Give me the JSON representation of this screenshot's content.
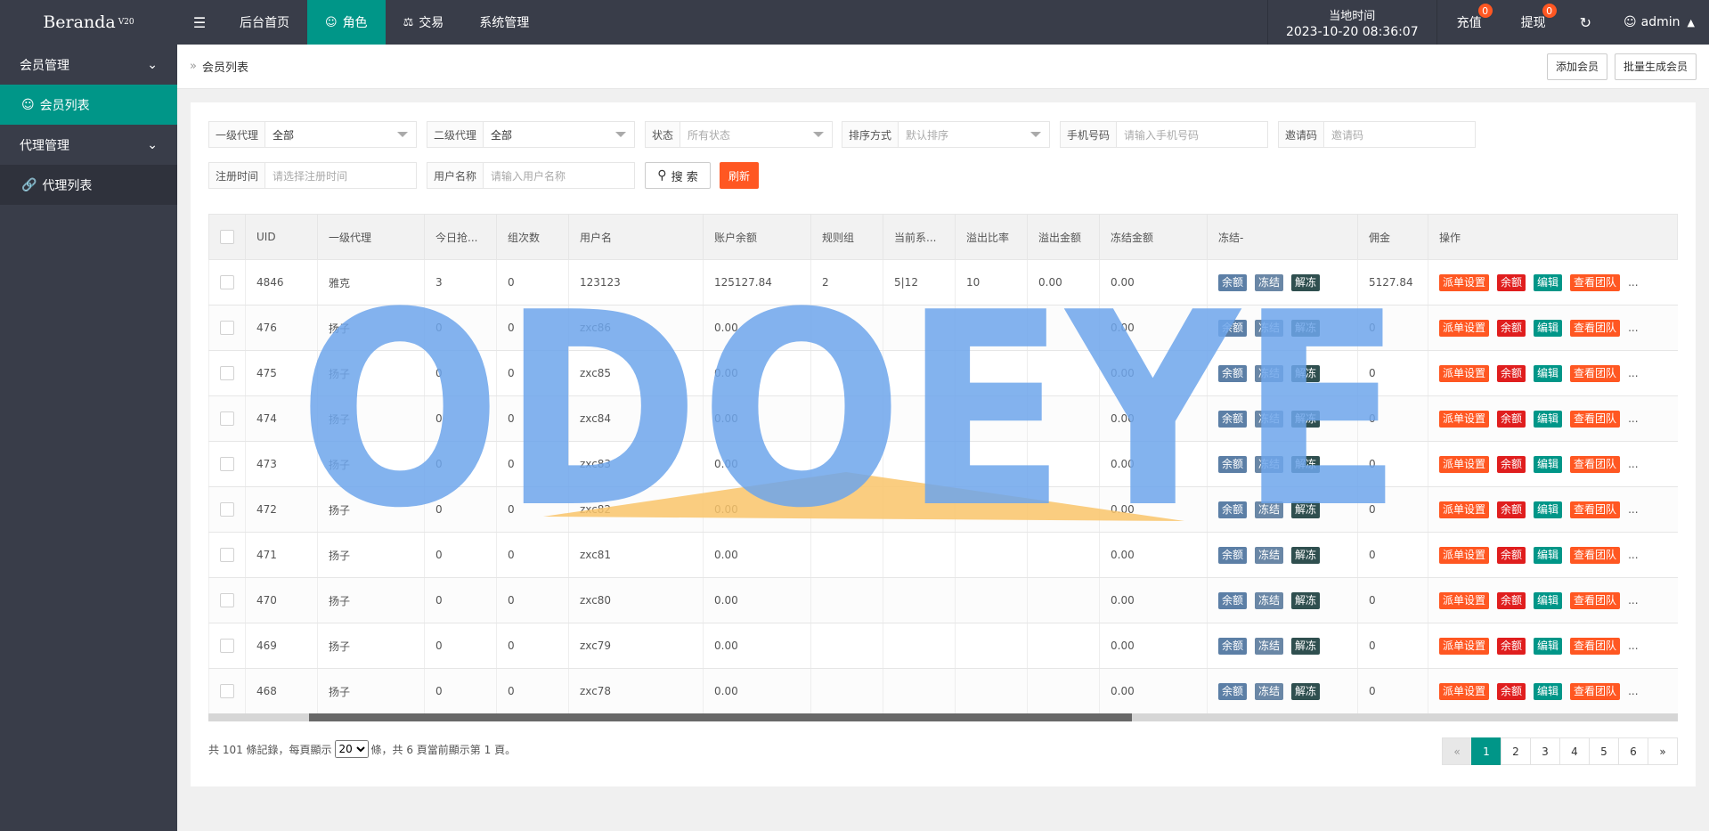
{
  "brand": {
    "name": "Beranda",
    "version": "V20"
  },
  "top_nav": {
    "menu_toggle_icon": "menu-icon",
    "items": [
      {
        "label": "后台首页",
        "icon": "",
        "active": false
      },
      {
        "label": "角色",
        "icon": "user-icon",
        "active": true
      },
      {
        "label": "交易",
        "icon": "scale-icon",
        "active": false
      },
      {
        "label": "系统管理",
        "icon": "",
        "active": false
      }
    ]
  },
  "header_right": {
    "time_label": "当地时间",
    "time_value": "2023-10-20 08:36:07",
    "recharge_label": "充值",
    "recharge_badge": "0",
    "withdraw_label": "提现",
    "withdraw_badge": "0",
    "refresh_icon": "refresh-icon",
    "user": "admin"
  },
  "sidebar": {
    "groups": [
      {
        "label": "会员管理",
        "items": [
          {
            "label": "会员列表",
            "active": true
          }
        ]
      },
      {
        "label": "代理管理",
        "items": [
          {
            "label": "代理列表",
            "active": false
          }
        ]
      }
    ]
  },
  "breadcrumb": {
    "title": "会员列表",
    "add_button": "添加会员",
    "batch_button": "批量生成会员"
  },
  "filters": {
    "agent1_label": "一级代理",
    "agent1_value": "全部",
    "agent2_label": "二级代理",
    "agent2_value": "全部",
    "status_label": "状态",
    "status_placeholder": "所有状态",
    "sort_label": "排序方式",
    "sort_placeholder": "默认排序",
    "phone_label": "手机号码",
    "phone_placeholder": "请输入手机号码",
    "invite_label": "邀请码",
    "invite_placeholder": "邀请码",
    "regtime_label": "注册时间",
    "regtime_placeholder": "请选择注册时间",
    "username_label": "用户名称",
    "username_placeholder": "请输入用户名称",
    "search_button": "搜 索",
    "refresh_button": "刷新"
  },
  "table": {
    "headers": [
      "UID",
      "一级代理",
      "今日抢...",
      "组次数",
      "用户名",
      "账户余额",
      "规则组",
      "当前系...",
      "溢出比率",
      "溢出金额",
      "冻结金额",
      "冻结-",
      "佣金",
      "操作"
    ],
    "actions": {
      "balance": "余额",
      "freeze": "冻结",
      "unfreeze": "解冻",
      "dispatch": "派单设置",
      "balance2": "余额",
      "edit": "编辑",
      "team": "查看团队",
      "more": "..."
    },
    "rows": [
      {
        "uid": "4846",
        "agent": "雅克",
        "today": "3",
        "groups": "0",
        "username": "123123",
        "balance": "125127.84",
        "rule": "2",
        "current": "5|12",
        "overflow_rate": "10",
        "overflow_amount": "0.00",
        "frozen": "0.00",
        "commission": "5127.84"
      },
      {
        "uid": "476",
        "agent": "扬子",
        "today": "0",
        "groups": "0",
        "username": "zxc86",
        "balance": "0.00",
        "rule": "",
        "current": "",
        "overflow_rate": "",
        "overflow_amount": "",
        "frozen": "0.00",
        "commission": "0"
      },
      {
        "uid": "475",
        "agent": "扬子",
        "today": "0",
        "groups": "0",
        "username": "zxc85",
        "balance": "0.00",
        "rule": "",
        "current": "",
        "overflow_rate": "",
        "overflow_amount": "",
        "frozen": "0.00",
        "commission": "0"
      },
      {
        "uid": "474",
        "agent": "扬子",
        "today": "0",
        "groups": "0",
        "username": "zxc84",
        "balance": "0.00",
        "rule": "",
        "current": "",
        "overflow_rate": "",
        "overflow_amount": "",
        "frozen": "0.00",
        "commission": "0"
      },
      {
        "uid": "473",
        "agent": "扬子",
        "today": "0",
        "groups": "0",
        "username": "zxc83",
        "balance": "0.00",
        "rule": "",
        "current": "",
        "overflow_rate": "",
        "overflow_amount": "",
        "frozen": "0.00",
        "commission": "0"
      },
      {
        "uid": "472",
        "agent": "扬子",
        "today": "0",
        "groups": "0",
        "username": "zxc82",
        "balance": "0.00",
        "rule": "",
        "current": "",
        "overflow_rate": "",
        "overflow_amount": "",
        "frozen": "0.00",
        "commission": "0"
      },
      {
        "uid": "471",
        "agent": "扬子",
        "today": "0",
        "groups": "0",
        "username": "zxc81",
        "balance": "0.00",
        "rule": "",
        "current": "",
        "overflow_rate": "",
        "overflow_amount": "",
        "frozen": "0.00",
        "commission": "0"
      },
      {
        "uid": "470",
        "agent": "扬子",
        "today": "0",
        "groups": "0",
        "username": "zxc80",
        "balance": "0.00",
        "rule": "",
        "current": "",
        "overflow_rate": "",
        "overflow_amount": "",
        "frozen": "0.00",
        "commission": "0"
      },
      {
        "uid": "469",
        "agent": "扬子",
        "today": "0",
        "groups": "0",
        "username": "zxc79",
        "balance": "0.00",
        "rule": "",
        "current": "",
        "overflow_rate": "",
        "overflow_amount": "",
        "frozen": "0.00",
        "commission": "0"
      },
      {
        "uid": "468",
        "agent": "扬子",
        "today": "0",
        "groups": "0",
        "username": "zxc78",
        "balance": "0.00",
        "rule": "",
        "current": "",
        "overflow_rate": "",
        "overflow_amount": "",
        "frozen": "0.00",
        "commission": "0"
      }
    ]
  },
  "footer": {
    "summary_prefix": "共 101 條記錄，每頁顯示",
    "page_size": "20",
    "summary_suffix": "條，共 6 頁當前顯示第 1 頁。"
  },
  "pager": {
    "prev": "«",
    "pages": [
      "1",
      "2",
      "3",
      "4",
      "5",
      "6"
    ],
    "current": "1",
    "next": "»"
  },
  "watermark": {
    "text": "ODOEYE"
  },
  "colors": {
    "topbar": "#393d49",
    "accent": "#009688",
    "danger": "#ff5722",
    "watermark_blue": "#6ea6ec",
    "watermark_orange": "#f9c46a"
  }
}
